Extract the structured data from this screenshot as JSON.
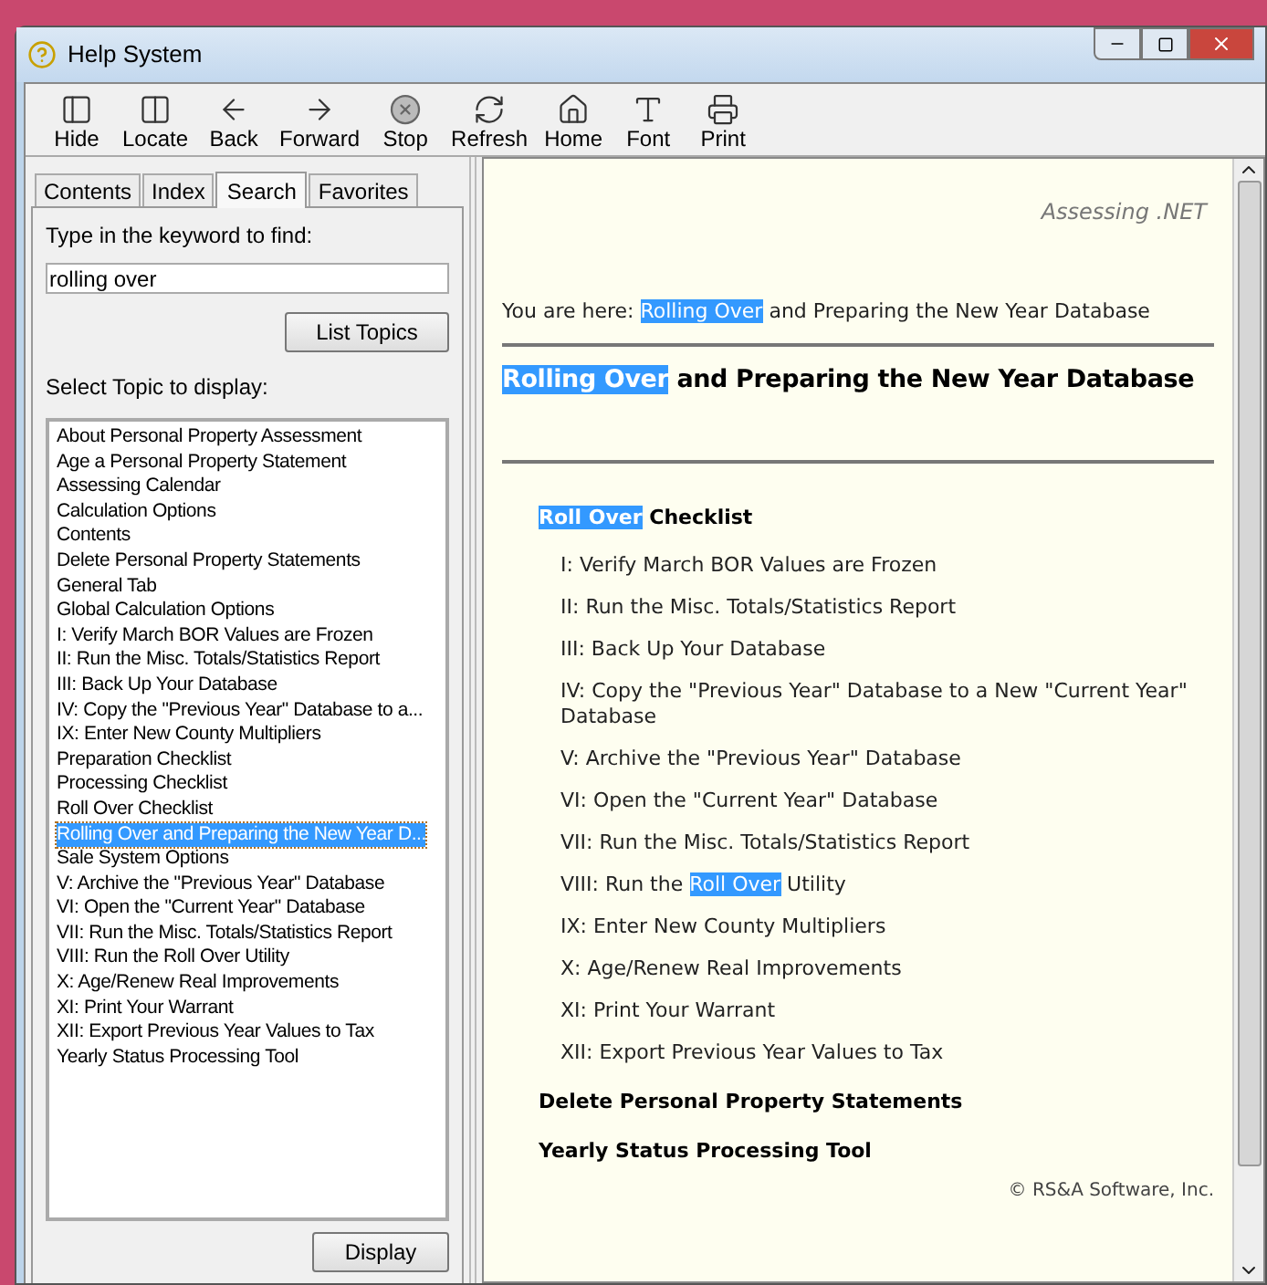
{
  "window": {
    "title": "Help System"
  },
  "toolbar": [
    {
      "label": "Hide",
      "kind": "hide"
    },
    {
      "label": "Locate",
      "kind": "locate"
    },
    {
      "label": "Back",
      "kind": "back"
    },
    {
      "label": "Forward",
      "kind": "forward"
    },
    {
      "label": "Stop",
      "kind": "stop"
    },
    {
      "label": "Refresh",
      "kind": "refresh"
    },
    {
      "label": "Home",
      "kind": "home"
    },
    {
      "label": "Font",
      "kind": "font"
    },
    {
      "label": "Print",
      "kind": "print"
    }
  ],
  "tabs": [
    {
      "label": "Contents",
      "selected": false
    },
    {
      "label": "Index",
      "selected": false
    },
    {
      "label": "Search",
      "selected": true
    },
    {
      "label": "Favorites",
      "selected": false
    }
  ],
  "search": {
    "label": "Type in the keyword to find:",
    "value": "rolling over",
    "button": "List Topics"
  },
  "topic_label": "Select Topic to display:",
  "topics": [
    {
      "label": "About Personal Property Assessment",
      "selected": false
    },
    {
      "label": "Age a Personal Property Statement",
      "selected": false
    },
    {
      "label": "Assessing Calendar",
      "selected": false
    },
    {
      "label": "Calculation Options",
      "selected": false
    },
    {
      "label": "Contents",
      "selected": false
    },
    {
      "label": "Delete Personal Property Statements",
      "selected": false
    },
    {
      "label": "General Tab",
      "selected": false
    },
    {
      "label": "Global Calculation Options",
      "selected": false
    },
    {
      "label": "I: Verify March BOR Values are Frozen",
      "selected": false
    },
    {
      "label": "II: Run the Misc. Totals/Statistics Report",
      "selected": false
    },
    {
      "label": "III: Back Up Your Database",
      "selected": false
    },
    {
      "label": "IV: Copy the \"Previous Year\" Database to a...",
      "selected": false
    },
    {
      "label": "IX: Enter New County Multipliers",
      "selected": false
    },
    {
      "label": "Preparation Checklist",
      "selected": false
    },
    {
      "label": "Processing Checklist",
      "selected": false
    },
    {
      "label": "Roll Over Checklist",
      "selected": false
    },
    {
      "label": "Rolling Over and Preparing the New Year D...",
      "selected": true
    },
    {
      "label": "Sale System Options",
      "selected": false
    },
    {
      "label": "V: Archive the \"Previous Year\" Database",
      "selected": false
    },
    {
      "label": "VI: Open the \"Current Year\" Database",
      "selected": false
    },
    {
      "label": "VII: Run the Misc. Totals/Statistics Report",
      "selected": false
    },
    {
      "label": "VIII: Run the Roll Over Utility",
      "selected": false
    },
    {
      "label": "X: Age/Renew Real Improvements",
      "selected": false
    },
    {
      "label": "XI: Print Your Warrant",
      "selected": false
    },
    {
      "label": "XII: Export Previous Year Values to Tax",
      "selected": false
    },
    {
      "label": "Yearly Status Processing Tool",
      "selected": false
    }
  ],
  "display_button": "Display",
  "content": {
    "brand": "Assessing .NET",
    "breadcrumb": [
      {
        "text": "You are here: ",
        "highlighted": false
      },
      {
        "text": "Rolling Over",
        "highlighted": true
      },
      {
        "text": " and Preparing the New Year Database",
        "highlighted": false
      }
    ],
    "heading": [
      {
        "text": "Rolling Over",
        "highlighted": true
      },
      {
        "text": " and Preparing the New Year Database",
        "highlighted": false
      }
    ],
    "section_title": [
      {
        "text": "Roll Over",
        "highlighted": true
      },
      {
        "text": " Checklist",
        "highlighted": false
      }
    ],
    "steps": [
      [
        {
          "text": "I: Verify March BOR Values are Frozen",
          "highlighted": false
        }
      ],
      [
        {
          "text": "II: Run the Misc. Totals/Statistics Report",
          "highlighted": false
        }
      ],
      [
        {
          "text": "III: Back Up Your Database",
          "highlighted": false
        }
      ],
      [
        {
          "text": "IV: Copy the \"Previous Year\" Database to a New \"Current Year\" Database",
          "highlighted": false
        }
      ],
      [
        {
          "text": "V: Archive the \"Previous Year\" Database",
          "highlighted": false
        }
      ],
      [
        {
          "text": "VI: Open the \"Current Year\" Database",
          "highlighted": false
        }
      ],
      [
        {
          "text": "VII: Run the Misc. Totals/Statistics Report",
          "highlighted": false
        }
      ],
      [
        {
          "text": "VIII: Run the ",
          "highlighted": false
        },
        {
          "text": "Roll Over",
          "highlighted": true
        },
        {
          "text": " Utility",
          "highlighted": false
        }
      ],
      [
        {
          "text": "IX: Enter New County Multipliers",
          "highlighted": false
        }
      ],
      [
        {
          "text": "X: Age/Renew Real Improvements",
          "highlighted": false
        }
      ],
      [
        {
          "text": "XI: Print Your Warrant",
          "highlighted": false
        }
      ],
      [
        {
          "text": "XII: Export Previous Year Values to Tax",
          "highlighted": false
        }
      ]
    ],
    "links": [
      "Delete Personal Property Statements",
      "Yearly Status Processing Tool"
    ],
    "copyright": "© RS&A Software, Inc."
  }
}
